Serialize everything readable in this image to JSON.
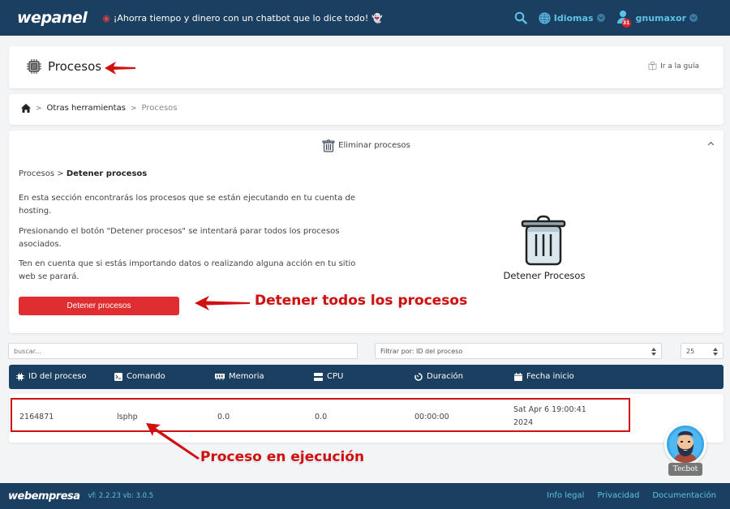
{
  "header": {
    "logo": "wepanel",
    "promo_text": "¡Ahorra tiempo y dinero con un chatbot que lo dice todo!",
    "promo_icon_left": "dart-target-icon",
    "promo_icon_right": "ghost-icon",
    "search_icon": "search-icon",
    "language_label": "Idiomas",
    "user_label": "gnumaxor",
    "notification_count": "31"
  },
  "page_title": {
    "icon": "cpu-chip-icon",
    "title": "Procesos",
    "guide_link": "Ir a la guía"
  },
  "breadcrumb": {
    "home_icon": "home-icon",
    "items": [
      "Otras herramientas",
      "Procesos"
    ],
    "separator": ">"
  },
  "panel": {
    "header_label": "Eliminar procesos",
    "sub_breadcrumb": {
      "parent": "Procesos",
      "separator": ">",
      "current": "Detener procesos"
    },
    "paragraphs": [
      "En esta sección encontrarás los procesos que se están ejecutando en tu cuenta de hosting.",
      "Presionando el botón \"Detener procesos\" se intentará parar todos los procesos asociados.",
      "Ten en cuenta que si estás importando datos o realizando alguna acción en tu sitio web se parará."
    ],
    "stop_button_label": "Detener procesos",
    "illustration_label": "Detener Procesos"
  },
  "annotations": {
    "stop_all": "Detener todos los procesos",
    "running_process": "Proceso en ejecución",
    "color": "#d01010"
  },
  "filters": {
    "search_placeholder": "buscar...",
    "filter_by": "Filtrar por: ID del proceso",
    "page_size": "25"
  },
  "table": {
    "columns": [
      {
        "label": "ID del proceso",
        "icon": "cpu-icon"
      },
      {
        "label": "Comando",
        "icon": "terminal-icon"
      },
      {
        "label": "Memoria",
        "icon": "memory-icon"
      },
      {
        "label": "CPU",
        "icon": "server-icon"
      },
      {
        "label": "Duración",
        "icon": "timer-icon"
      },
      {
        "label": "Fecha inicio",
        "icon": "calendar-icon"
      }
    ],
    "rows": [
      {
        "pid": "2164871",
        "command": "lsphp",
        "memory": "0.0",
        "cpu": "0.0",
        "duration": "00:00:00",
        "start_line1": "Sat Apr 6 19:00:41",
        "start_line2": "2024"
      }
    ]
  },
  "chatbot": {
    "label": "Tecbot"
  },
  "footer": {
    "logo": "webempresa",
    "version": "vf: 2.2.23 vb: 3.0.5",
    "links": [
      "Info legal",
      "Privacidad",
      "Documentación"
    ]
  },
  "colors": {
    "navy": "#1b3f61",
    "accent": "#5ec2e6",
    "danger": "#df2d32"
  }
}
